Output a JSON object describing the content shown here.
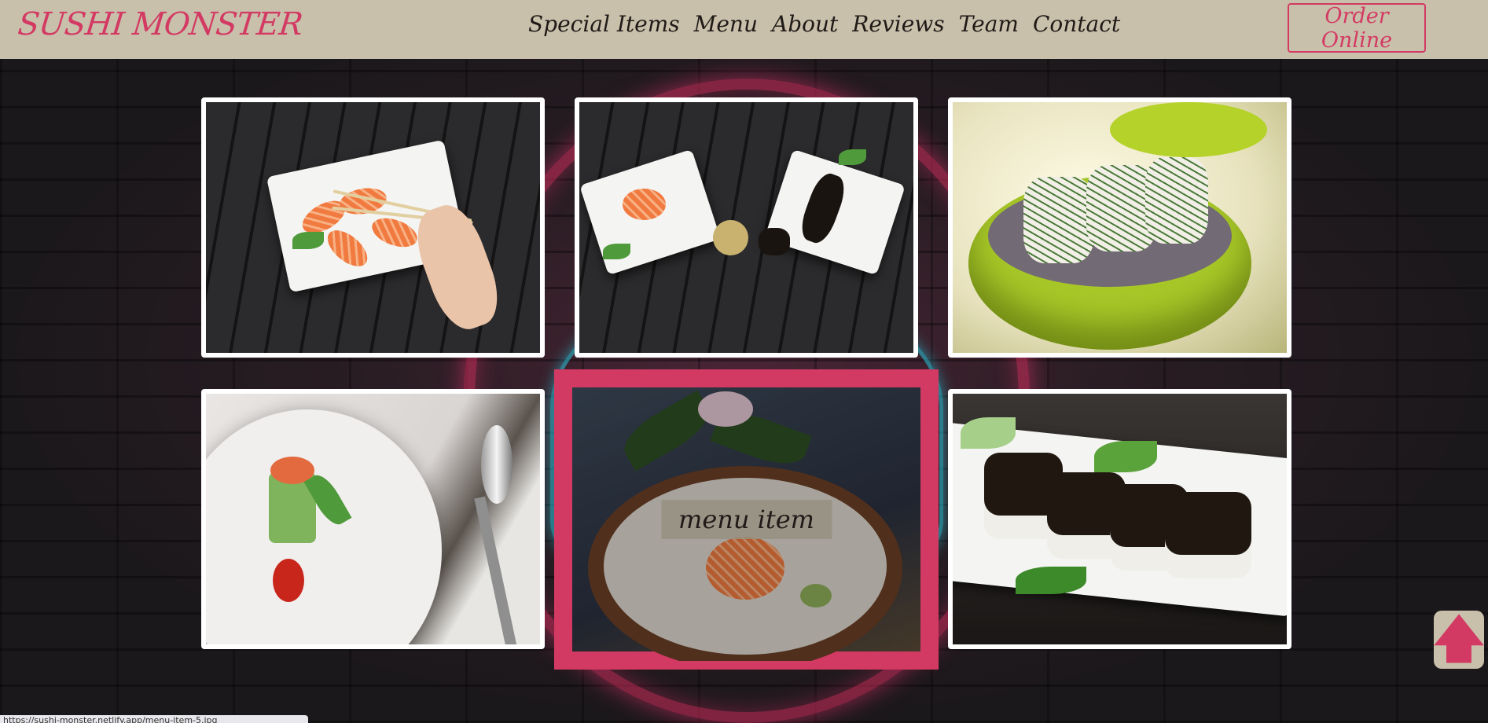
{
  "header": {
    "logo": "SUSHI MONSTER",
    "nav": [
      "Special Items",
      "Menu",
      "About",
      "Reviews",
      "Team",
      "Contact"
    ],
    "order_label": "Order Online"
  },
  "gallery": {
    "items": [
      {
        "alt": "sushi-with-chopsticks"
      },
      {
        "alt": "sashimi-plates"
      },
      {
        "alt": "sushi-rolls-in-bowl"
      },
      {
        "alt": "cucumber-roll-appetizer"
      },
      {
        "alt": "sashimi-platter",
        "caption": "menu item"
      },
      {
        "alt": "eel-nigiri"
      }
    ]
  },
  "scroll_top_icon": "arrow-up-icon",
  "status_url": "https://sushi-monster.netlify.app/menu-item-5.jpg",
  "colors": {
    "accent": "#d33a63",
    "header_bg": "#c9c0ab"
  }
}
